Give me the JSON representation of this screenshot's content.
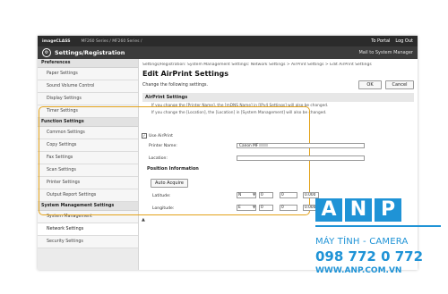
{
  "topbar": {
    "product": "imageCLASS",
    "model": "MF260 Series / MF260 Series /",
    "links": [
      "To Portal",
      "Log Out"
    ]
  },
  "titlebar": {
    "title": "Settings/Registration",
    "mail_link": "Mail to System Manager"
  },
  "sidebar": {
    "groups": [
      {
        "heading": "Preferences",
        "items": [
          "Paper Settings",
          "Sound Volume Control",
          "Display Settings",
          "Timer Settings"
        ]
      },
      {
        "heading": "Function Settings",
        "items": [
          "Common Settings",
          "Copy Settings",
          "Fax Settings",
          "Scan Settings",
          "Printer Settings",
          "Output Report Settings"
        ]
      },
      {
        "heading": "System Management Settings",
        "items": [
          "System Management",
          "Network Settings",
          "Security Settings"
        ]
      }
    ],
    "active_item": "Network Settings"
  },
  "main": {
    "breadcrumb": "Settings/Registration: System Management Settings: Network Settings > AirPrint Settings > Edit AirPrint Settings",
    "title": "Edit AirPrint Settings",
    "instruction": "Change the following settings.",
    "ok_label": "OK",
    "cancel_label": "Cancel",
    "section_title": "AirPrint Settings",
    "notes": [
      "If you change the [Printer Name], the [mDNS Name] in [IPv4 Settings] will also be changed.",
      "If you change the [Location], the [Location] in [System Management] will also be changed."
    ],
    "use_airprint_label": "Use AirPrint",
    "printer_name_label": "Printer Name:",
    "printer_name_value": "Canon MF",
    "location_label": "Location:",
    "location_value": "",
    "position_heading": "Position Information",
    "auto_acquire_label": "Auto Acquire",
    "latitude_label": "Latitude:",
    "longitude_label": "Longitude:",
    "latitude": {
      "hemisphere": "N",
      "deg": "0",
      "min": "0",
      "sec": "0.000"
    },
    "longitude": {
      "hemisphere": "E",
      "deg": "0",
      "min": "0",
      "sec": "0.000"
    }
  },
  "watermark": {
    "logo": "ANP",
    "line1": "MÁY TÍNH - CAMERA",
    "line2": "098 772 0 772",
    "line3": "WWW.ANP.COM.VN",
    "color": "#1f93d6"
  }
}
